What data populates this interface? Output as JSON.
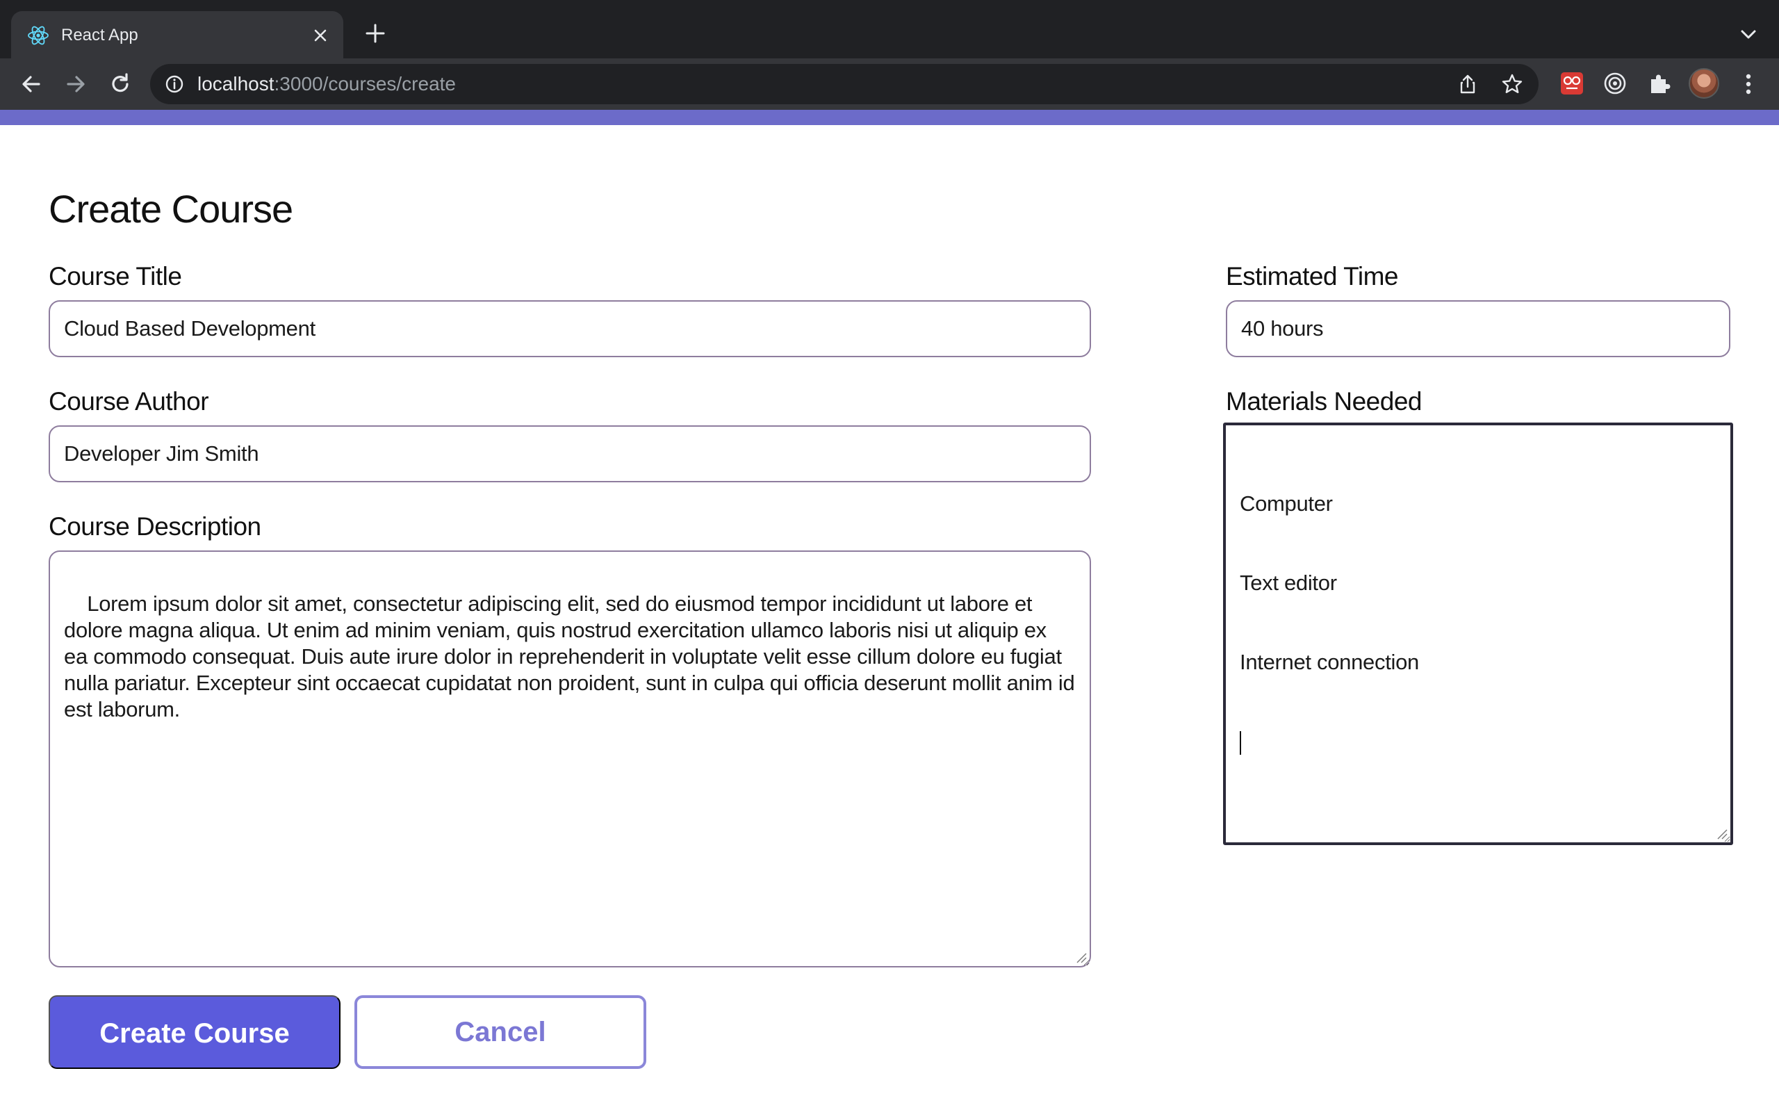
{
  "browser": {
    "tab_title": "React App",
    "url_host": "localhost",
    "url_path": ":3000/courses/create"
  },
  "page": {
    "heading": "Create Course",
    "course_title": {
      "label": "Course Title",
      "value": "Cloud Based Development"
    },
    "course_author": {
      "label": "Course Author",
      "value": "Developer Jim Smith"
    },
    "course_description": {
      "label": "Course Description",
      "value": "Lorem ipsum dolor sit amet, consectetur adipiscing elit, sed do eiusmod tempor incididunt ut labore et dolore magna aliqua. Ut enim ad minim veniam, quis nostrud exercitation ullamco laboris nisi ut aliquip ex ea commodo consequat. Duis aute irure dolor in reprehenderit in voluptate velit esse cillum dolore eu fugiat nulla pariatur. Excepteur sint occaecat cupidatat non proident, sunt in culpa qui officia deserunt mollit anim id est laborum."
    },
    "estimated_time": {
      "label": "Estimated Time",
      "value": "40 hours"
    },
    "materials_needed": {
      "label": "Materials Needed",
      "lines": [
        "Computer",
        "Text editor",
        "Internet connection"
      ]
    },
    "buttons": {
      "submit": "Create Course",
      "cancel": "Cancel"
    }
  },
  "colors": {
    "accent_bar": "#6c6bc9",
    "primary_button": "#5b5bdc",
    "secondary_button_border": "#8b87d9"
  }
}
